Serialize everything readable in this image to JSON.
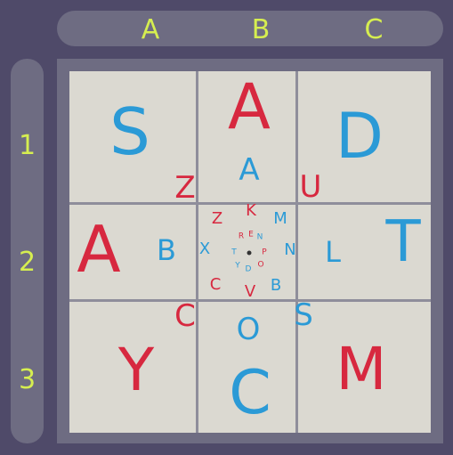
{
  "columns": [
    "A",
    "B",
    "C"
  ],
  "rows": [
    "1",
    "2",
    "3"
  ],
  "colors": {
    "background": "#4f4a69",
    "header": "#6e6c82",
    "label": "#d6ee50",
    "cell": "#dbd9d1",
    "red": "#d7283f",
    "blue": "#2b9ad6"
  },
  "cells": {
    "a1": "S",
    "b1": "A",
    "c1": "D",
    "a2": "A",
    "c2": "T",
    "a3": "Y",
    "b3": "C",
    "c3": "M"
  },
  "ring1": {
    "top": "A",
    "left": "B",
    "right": "L",
    "bottom": "O",
    "top_left": "Z",
    "top_right": "U",
    "bottom_left": "C",
    "bottom_right": "S"
  },
  "ring2": {
    "top": "K",
    "top_left": "Z",
    "top_right": "M",
    "left": "X",
    "right": "N",
    "bottom_left": "C",
    "bottom": "V",
    "bottom_right": "B"
  },
  "ring3": {
    "r": "R",
    "e": "E",
    "n": "N",
    "t": "T",
    "p": "P",
    "y": "Y",
    "o": "O",
    "d": "D"
  }
}
